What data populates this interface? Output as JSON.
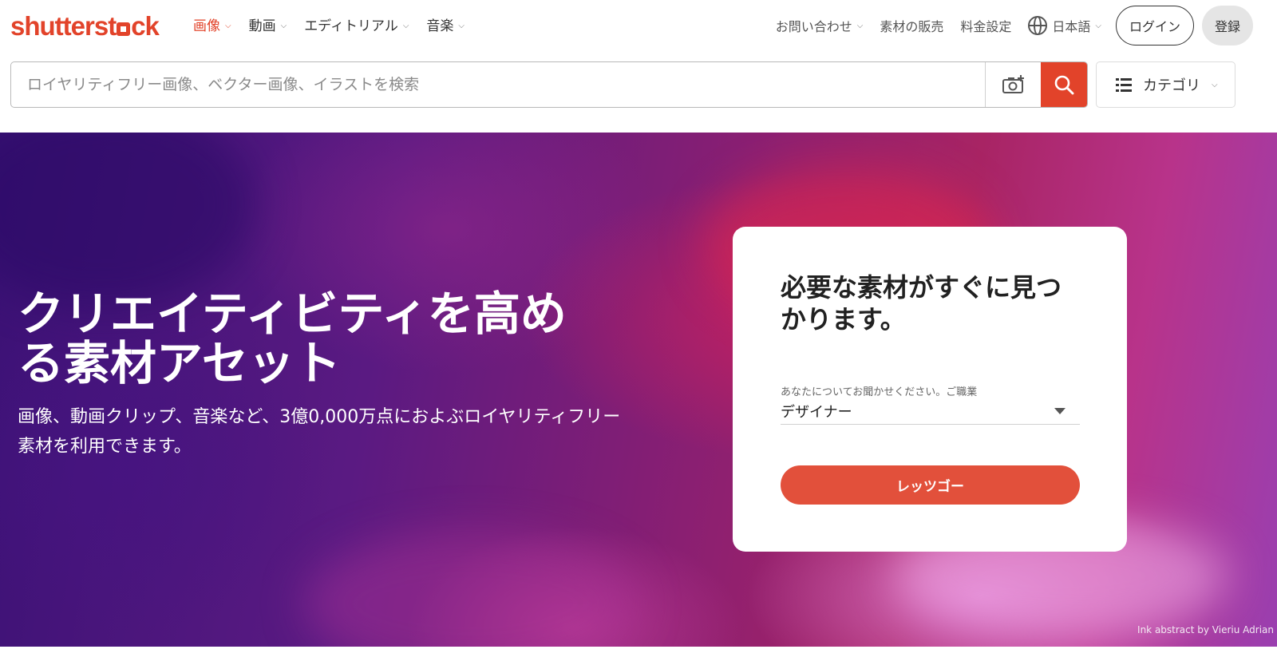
{
  "brand": {
    "logo_pre": "shutterst",
    "logo_post": "ck",
    "accent": "#e2432a"
  },
  "nav": {
    "items": [
      {
        "label": "画像",
        "active": true
      },
      {
        "label": "動画"
      },
      {
        "label": "エディトリアル"
      },
      {
        "label": "音楽"
      }
    ]
  },
  "header_right": {
    "contact": "お問い合わせ",
    "sell": "素材の販売",
    "pricing": "料金設定",
    "language": "日本語",
    "login": "ログイン",
    "register": "登録"
  },
  "search": {
    "placeholder": "ロイヤリティフリー画像、ベクター画像、イラストを検索",
    "category_label": "カテゴリ"
  },
  "hero": {
    "title": "クリエイティビティを高める素材アセット",
    "subtitle": "画像、動画クリップ、音楽など、3億0,000万点におよぶロイヤリティフリー素材を利用できます。",
    "credit": "Ink abstract by Vieriu Adrian"
  },
  "card": {
    "title": "必要な素材がすぐに見つかります。",
    "label": "あなたについてお聞かせください。ご職業",
    "selected": "デザイナー",
    "button": "レッツゴー"
  },
  "icons": {
    "nav_chevron": "chevron-down-icon",
    "globe": "globe-icon",
    "camera": "camera-search-icon",
    "search": "search-icon",
    "category": "list-icon",
    "select": "triangle-down-icon"
  }
}
